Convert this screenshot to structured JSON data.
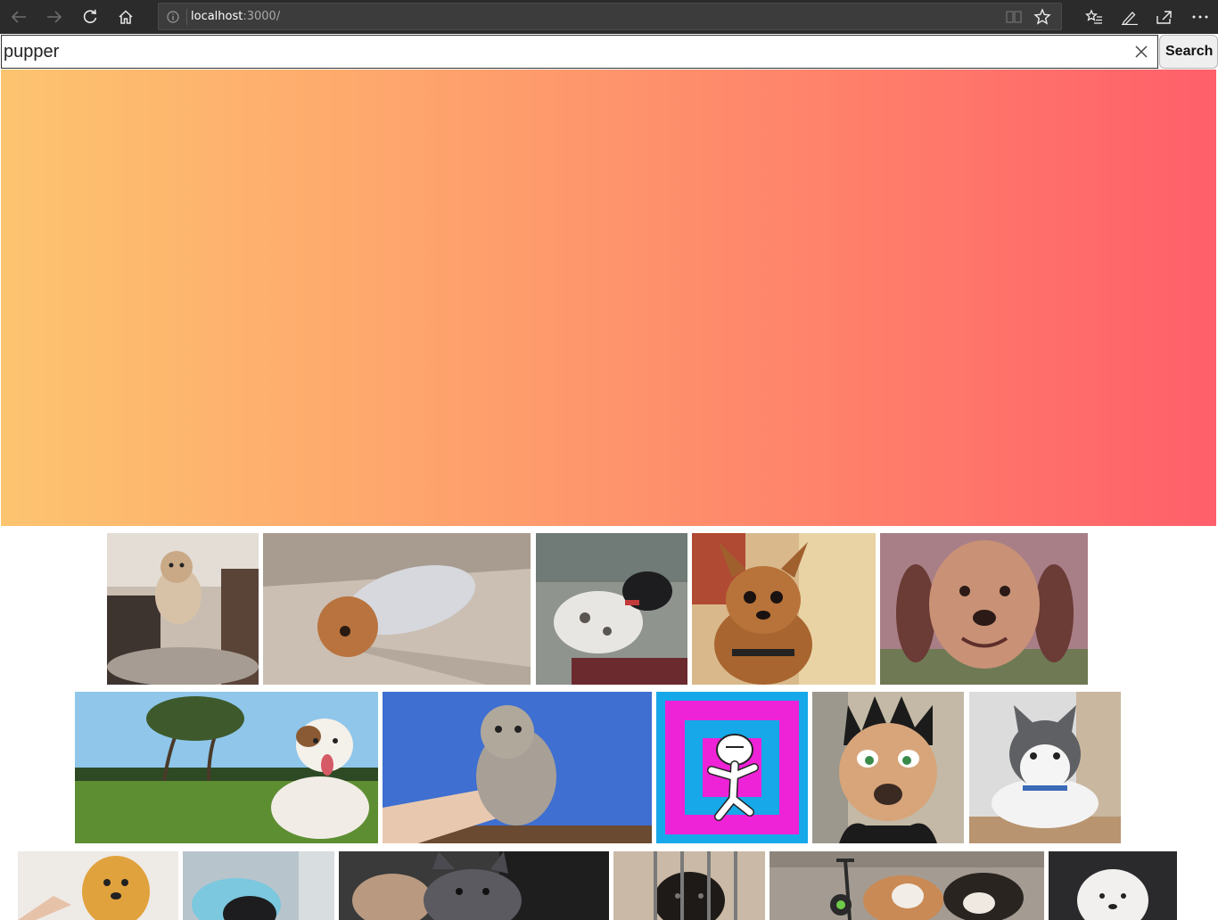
{
  "browser": {
    "url_host": "localhost",
    "url_path": ":3000/"
  },
  "search": {
    "value": "pupper",
    "button_label": "Search"
  },
  "hero": {
    "gradient_start": "#fdc46f",
    "gradient_end": "#ff5f6a"
  },
  "gallery": {
    "rows": 3,
    "tiles": [
      "gif-jumping-terrier",
      "gif-pomeranian-in-hoodie",
      "gif-dog-on-couch",
      "gif-surprised-chihuahua",
      "gif-smiling-hound",
      "gif-jack-russell-in-field",
      "gif-held-pomeranian-puppy",
      "gif-cartoon-dancer",
      "gif-cartoon-dog-mask",
      "gif-husky-puppy",
      "gif-pomeranian-brushing",
      "gif-pug-bath",
      "gif-french-bulldog",
      "gif-puppy-in-crate",
      "gif-beagles-with-scooter",
      "gif-white-fluffy-puppy"
    ]
  }
}
